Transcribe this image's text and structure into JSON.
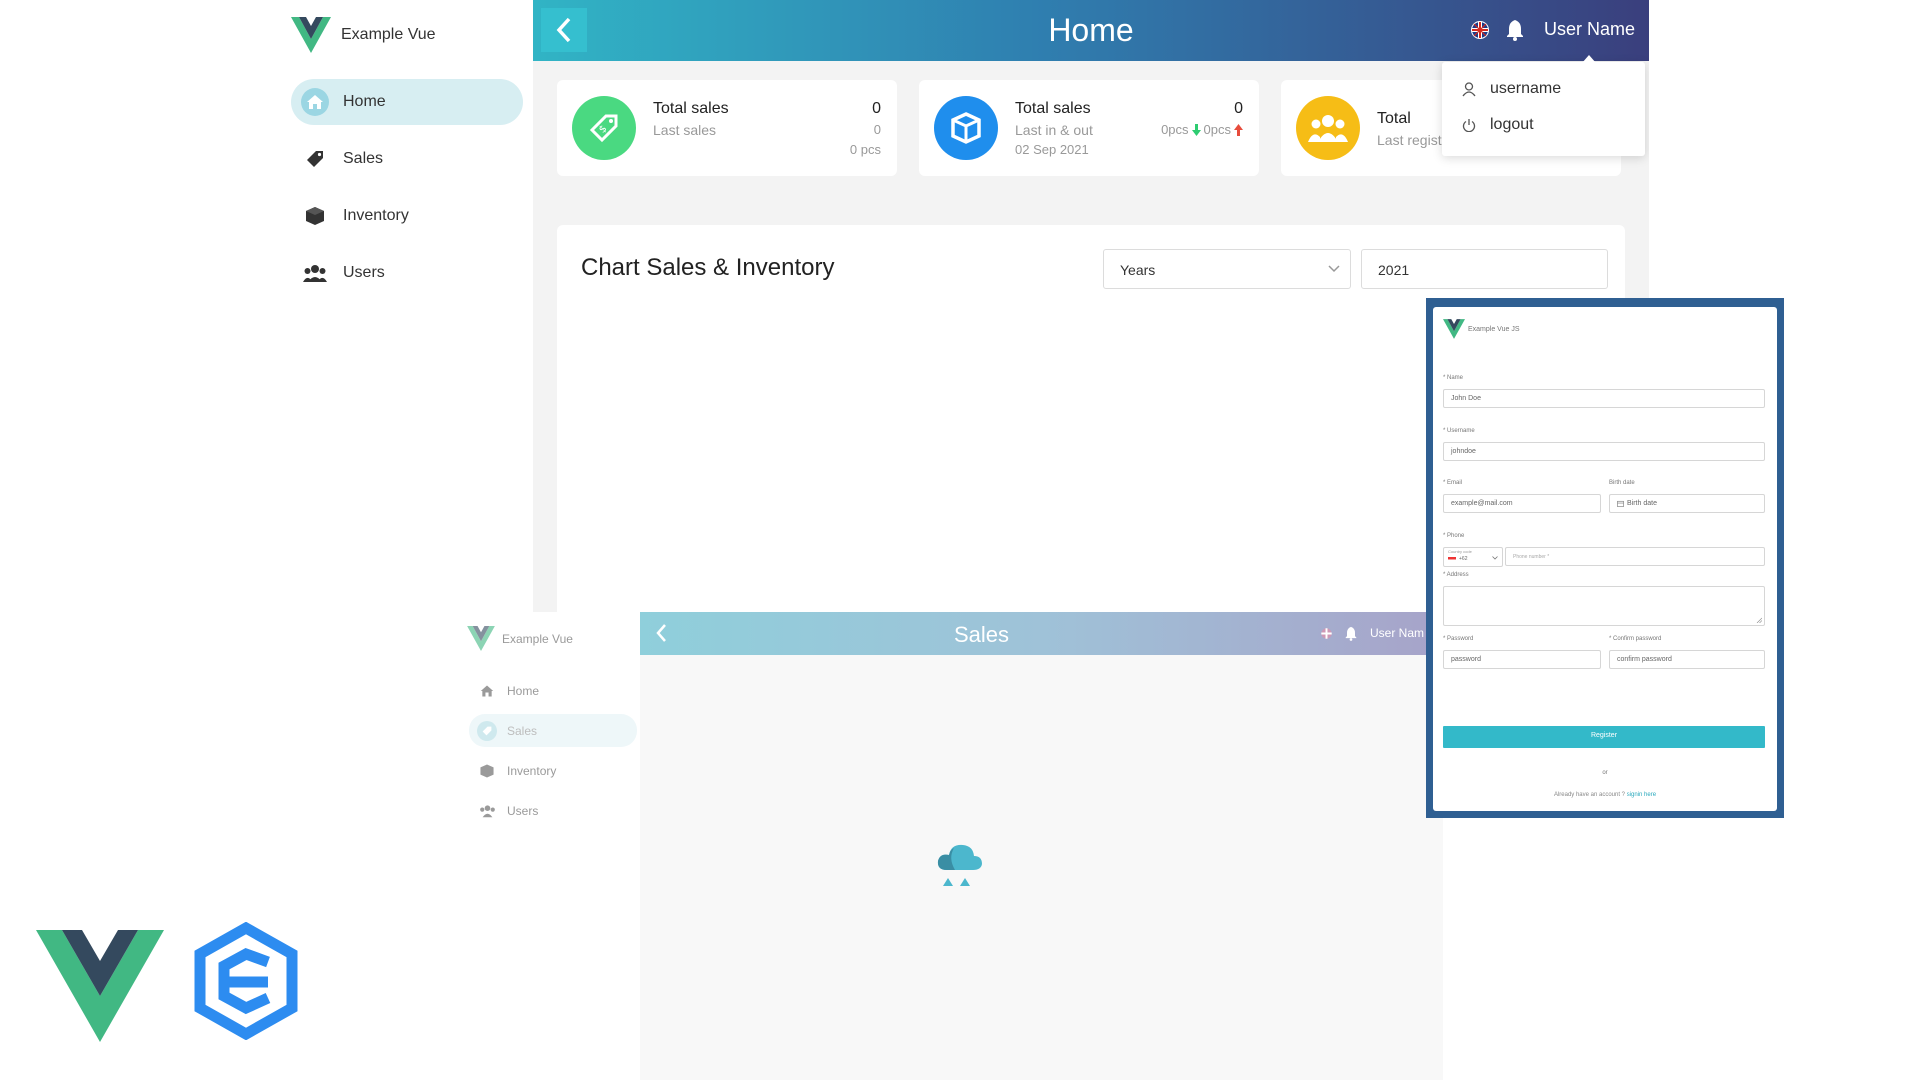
{
  "home": {
    "brand": "Example Vue",
    "sidebar": [
      {
        "label": "Home",
        "icon": "home-icon",
        "active": true
      },
      {
        "label": "Sales",
        "icon": "tag-icon"
      },
      {
        "label": "Inventory",
        "icon": "box-icon"
      },
      {
        "label": "Users",
        "icon": "users-icon"
      }
    ],
    "header": {
      "title": "Home",
      "user_name": "User Name",
      "flag_icon": "uk-flag-icon",
      "bell_icon": "bell-icon"
    },
    "cards": [
      {
        "title": "Total sales",
        "subtitle": "Last sales",
        "value": "0",
        "value2": "0",
        "value3": "0 pcs",
        "color": "#4ad981"
      },
      {
        "title": "Total sales",
        "subtitle": "Last in & out",
        "date": "02 Sep 2021",
        "value": "0",
        "in": "0pcs",
        "out": "0pcs",
        "color": "#1f8eed"
      },
      {
        "title": "Total",
        "subtitle": "Last regist",
        "color": "#f6bd16"
      }
    ],
    "chart": {
      "title": "Chart Sales & Inventory",
      "period_select": "Years",
      "year_input": "2021"
    },
    "user_menu": {
      "username": "username",
      "logout": "logout"
    }
  },
  "sales": {
    "brand": "Example Vue",
    "sidebar": [
      {
        "label": "Home"
      },
      {
        "label": "Sales",
        "active": true
      },
      {
        "label": "Inventory"
      },
      {
        "label": "Users"
      }
    ],
    "header": {
      "title": "Sales",
      "user_name": "User Nam"
    }
  },
  "register": {
    "brand": "Example Vue JS",
    "name_label": "* Name",
    "name_value": "John Doe",
    "username_label": "* Username",
    "username_value": "johndoe",
    "email_label": "* Email",
    "email_value": "example@mail.com",
    "birth_label": "Birth date",
    "birth_placeholder": "Birth date",
    "phone_label": "* Phone",
    "country_code_label": "Country code",
    "country_code_value": "+62",
    "phone_placeholder": "Phone number *",
    "address_label": "* Address",
    "password_label": "* Password",
    "password_placeholder": "password",
    "confirm_label": "* Confirm password",
    "confirm_placeholder": "confirm password",
    "register_button": "Register",
    "or_text": "or",
    "signin_prompt": "Already have an account ?",
    "signin_link": "signin here"
  },
  "colors": {
    "accent": "#31b4c5",
    "vue_green": "#41b883",
    "vue_dark": "#34495e",
    "blue_logo": "#2d8cf0"
  }
}
